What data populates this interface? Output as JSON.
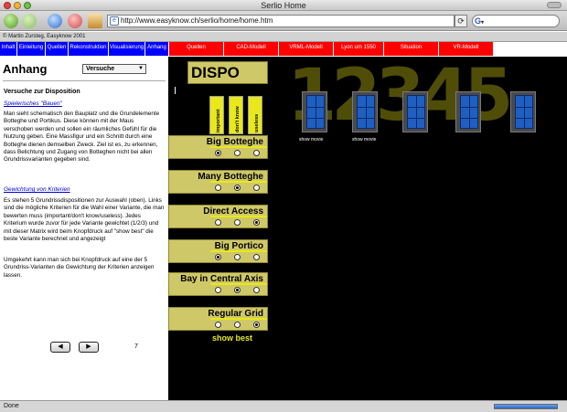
{
  "window": {
    "title": "Serlio Home"
  },
  "toolbar": {
    "url": "http://www.easyknow.ch/serlio/home/home.htm",
    "search_glyph": "G",
    "search_caret": "▾"
  },
  "copyright": "© Martin Zursteg, Easyknow 2001",
  "nav_blue": [
    "Inhalt",
    "Einleitung",
    "Quellen",
    "Rekonstruktion",
    "Visualisierung",
    "Anhang"
  ],
  "nav_red": [
    "Quellen",
    "CAD-Modell",
    "VRML-Modell",
    "Lyon um 1550",
    "Situation",
    "VR-Modell"
  ],
  "left": {
    "title": "Anhang",
    "select_value": "Versuche",
    "heading": "Versuche zur Disposition",
    "link1": "Spielerisches \"Bauen\"",
    "para1": "Man sieht schematisch den Bauplatz und die Grundelemente Botteghe und Portikus. Diese können mit der Maus verschoben werden und sollen ein räumliches Gefühl für die Nutzung geben. Eine Massfigur und ein Schnitt durch eine Botteghe dienen demselben Zweck. Ziel ist es, zu erkennen, dass Belichtung und Zugang von Botteghen nicht bei allen Grundrissvarianten gegeben sind.",
    "link2": "Gewichtung von Kriterien",
    "para2": "Es stehen 5 Grundrissdispositionen zur Auswahl (oben). Links sind die mögliche Kriterien für die Wahl einer Variante, die man bewerten muss (important/don't know/useless). Jedes Kriterium wurde zuvor für jede Variante gewichtet (1/2/3) und mit dieser Matrix wird beim Knopfdruck auf \"show best\" die beste Variante berechnet und angezeigt",
    "para3": "Umgekehrt kann man sich bei Knopfdruck auf eine der 5 Grundriss-Varianten die Gewichtung der Kriterien anzeigen lassen.",
    "prev": "◀",
    "next": "▶",
    "page": "7"
  },
  "app": {
    "title": "DISPO",
    "columns": [
      "important",
      "don't know",
      "useless"
    ],
    "variants": [
      {
        "label": "Big Botteghe",
        "selected": 0
      },
      {
        "label": "Many Botteghe",
        "selected": 1
      },
      {
        "label": "Direct Access",
        "selected": 2
      },
      {
        "label": "Big Portico",
        "selected": 0
      },
      {
        "label": "Bay in Central Axis",
        "selected": 1
      },
      {
        "label": "Regular Grid",
        "selected": 2
      }
    ],
    "show_best": "show best",
    "numbers": "12345",
    "show_movie": "show movie"
  },
  "status": "Done",
  "colors": {
    "blue_nav": "#0000ff",
    "red_nav": "#ff0000",
    "panel": "#cfc868",
    "accent_yellow": "#e8e81a"
  }
}
